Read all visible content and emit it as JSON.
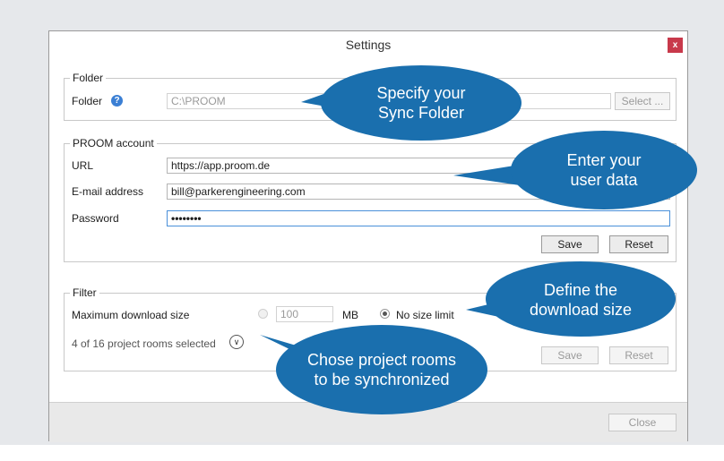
{
  "window": {
    "title": "Settings",
    "close_glyph": "x"
  },
  "folder_group": {
    "legend": "Folder",
    "label": "Folder",
    "help_icon": "?",
    "path_value": "C:\\PROOM",
    "select_label": "Select ..."
  },
  "account_group": {
    "legend": "PROOM account",
    "url_label": "URL",
    "url_value": "https://app.proom.de",
    "email_label": "E-mail address",
    "email_value": "bill@parkerengineering.com",
    "password_label": "Password",
    "password_value": "••••••••",
    "save_label": "Save",
    "reset_label": "Reset"
  },
  "filter_group": {
    "legend": "Filter",
    "max_size_label": "Maximum download size",
    "size_value": "100",
    "unit_label": "MB",
    "no_limit_label": "No size limit",
    "rooms_selected": "4 of 16 project rooms selected",
    "save_label": "Save",
    "reset_label": "Reset"
  },
  "footer": {
    "close_label": "Close"
  },
  "callouts": {
    "sync_folder": {
      "line1": "Specify your",
      "line2": "Sync Folder"
    },
    "user_data": {
      "line1": "Enter your",
      "line2": "user data"
    },
    "download_size": {
      "line1": "Define the",
      "line2": "download size"
    },
    "project_rooms": {
      "line1": "Chose project rooms",
      "line2": "to be synchronized"
    }
  },
  "colors": {
    "callout": "#1a6fae",
    "accent": "#3b7fd4",
    "close": "#c8394b"
  },
  "icons": [
    "help-icon",
    "close-icon",
    "chevron-down-icon"
  ]
}
